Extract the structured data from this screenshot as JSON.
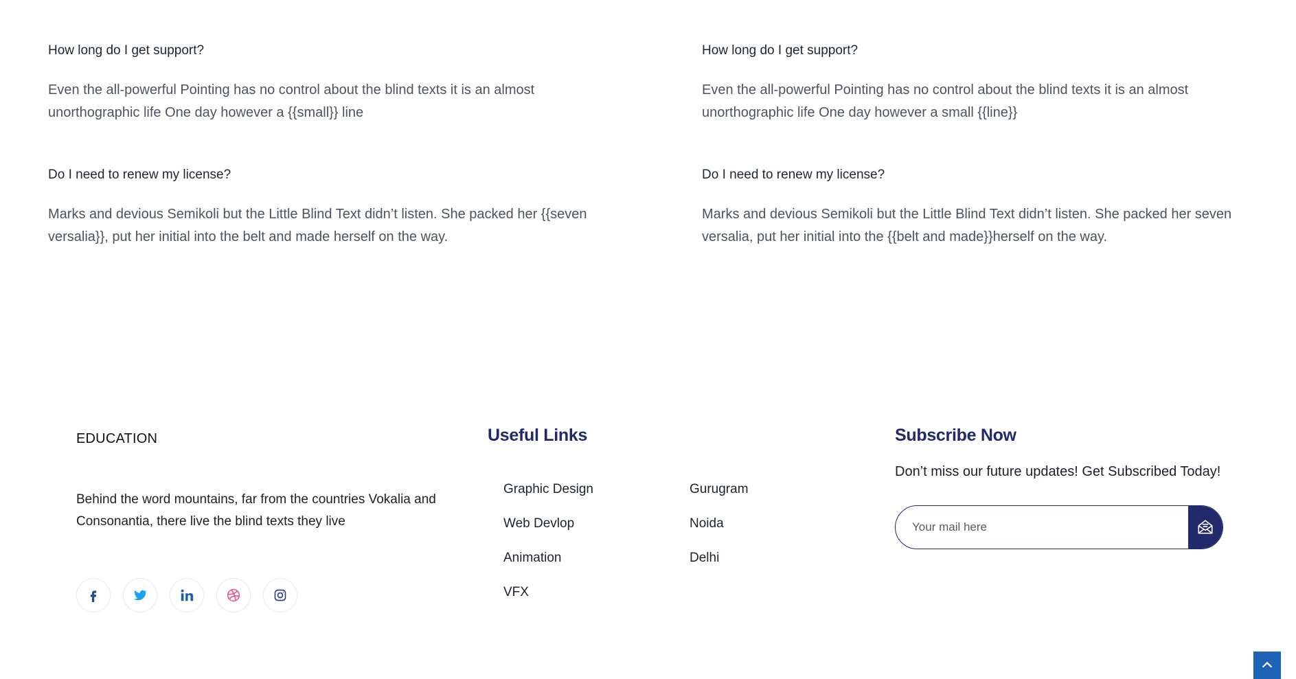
{
  "faq": {
    "left": [
      {
        "question": "How long do I get support?",
        "answer": "Even the all-powerful Pointing has no control about the blind texts it is an almost unorthographic life One day however a {{small}} line"
      },
      {
        "question": "Do I need to renew my license?",
        "answer": "Marks and devious Semikoli but the Little Blind Text didn’t listen. She packed her {{seven versalia}}, put her initial into the belt and made herself on the way."
      }
    ],
    "right": [
      {
        "question": "How long do I get support?",
        "answer": "Even the all-powerful Pointing has no control about the blind texts it is an almost unorthographic life One day however a small {{line}}"
      },
      {
        "question": "Do I need to renew my license?",
        "answer": "Marks and devious Semikoli but the Little Blind Text didn’t listen. She packed her seven versalia, put her initial into the {{belt and made}}herself on the way."
      }
    ]
  },
  "footer": {
    "brand": "EDUCATION",
    "brand_text": "Behind the word mountains, far from the countries Vokalia and Consonantia, there live the blind texts they live",
    "socials": [
      {
        "icon": "facebook-icon",
        "color": "#2a4a8c"
      },
      {
        "icon": "twitter-icon",
        "color": "#1da1f2"
      },
      {
        "icon": "linkedin-icon",
        "color": "#1e5fa8"
      },
      {
        "icon": "dribbble-icon",
        "color": "#ea4c89"
      },
      {
        "icon": "instagram-icon",
        "color": "#2b3d8f"
      }
    ],
    "links_title": "Useful Links",
    "links_col1": [
      "Graphic Design",
      "Web Devlop",
      "Animation",
      "VFX"
    ],
    "links_col2": [
      "Gurugram",
      "Noida",
      "Delhi"
    ],
    "subscribe_title": "Subscribe Now",
    "subscribe_text": "Don’t miss our future updates! Get Subscribed Today!",
    "subscribe_placeholder": "Your mail here",
    "subscribe_icon": "envelope-icon"
  },
  "scroll_top_icon": "chevron-up-icon",
  "colors": {
    "heading": "#202a6b",
    "button": "#232a6b",
    "scroll_top": "#1c63b6"
  }
}
